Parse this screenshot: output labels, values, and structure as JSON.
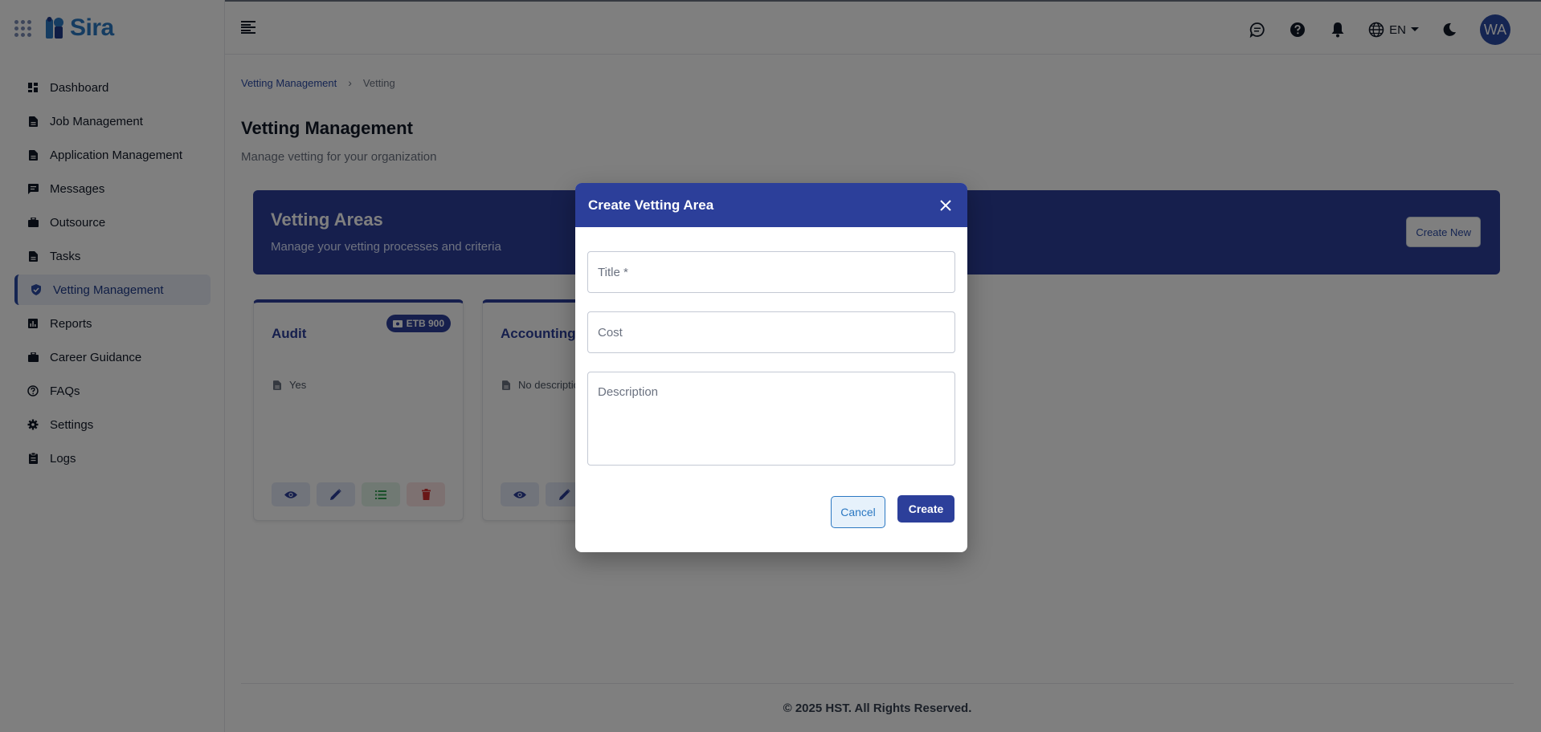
{
  "brand": {
    "name": "Sira"
  },
  "sidebar": {
    "items": [
      {
        "label": "Dashboard",
        "icon": "dashboard-icon"
      },
      {
        "label": "Job Management",
        "icon": "document-icon"
      },
      {
        "label": "Application Management",
        "icon": "document-icon"
      },
      {
        "label": "Messages",
        "icon": "message-icon"
      },
      {
        "label": "Outsource",
        "icon": "briefcase-icon"
      },
      {
        "label": "Tasks",
        "icon": "tasks-icon"
      },
      {
        "label": "Vetting Management",
        "icon": "shield-check-icon",
        "active": true
      },
      {
        "label": "Reports",
        "icon": "bar-chart-icon"
      },
      {
        "label": "Career Guidance",
        "icon": "briefcase-icon"
      },
      {
        "label": "FAQs",
        "icon": "help-circle-icon"
      },
      {
        "label": "Settings",
        "icon": "gear-icon"
      },
      {
        "label": "Logs",
        "icon": "clipboard-icon"
      }
    ]
  },
  "topbar": {
    "language": "EN",
    "avatar_initials": "WA",
    "icons": [
      "chat-icon",
      "help-icon",
      "bell-icon",
      "globe-icon",
      "moon-icon"
    ]
  },
  "breadcrumb": {
    "parent": "Vetting Management",
    "separator": "›",
    "current": "Vetting"
  },
  "page": {
    "title": "Vetting Management",
    "subtitle": "Manage vetting for your organization"
  },
  "banner": {
    "title": "Vetting Areas",
    "subtitle": "Manage your vetting processes and criteria",
    "create_label": "Create New"
  },
  "cards": [
    {
      "title": "Audit",
      "badge": "ETB 900",
      "description": "Yes"
    },
    {
      "title": "Accounting",
      "badge": "",
      "description": "No description"
    }
  ],
  "footer": {
    "text": "© 2025 HST. All Rights Reserved."
  },
  "modal": {
    "title": "Create Vetting Area",
    "title_placeholder": "Title *",
    "cost_placeholder": "Cost",
    "description_placeholder": "Description",
    "title_value": "",
    "cost_value": "",
    "description_value": "",
    "cancel_label": "Cancel",
    "create_label": "Create"
  },
  "colors": {
    "primary": "#2c3f9a",
    "brand_blue": "#2b78c2",
    "overlay": "rgba(0,0,0,0.5)",
    "delete_red": "#d32f2f",
    "list_green": "#2e9e4f"
  }
}
